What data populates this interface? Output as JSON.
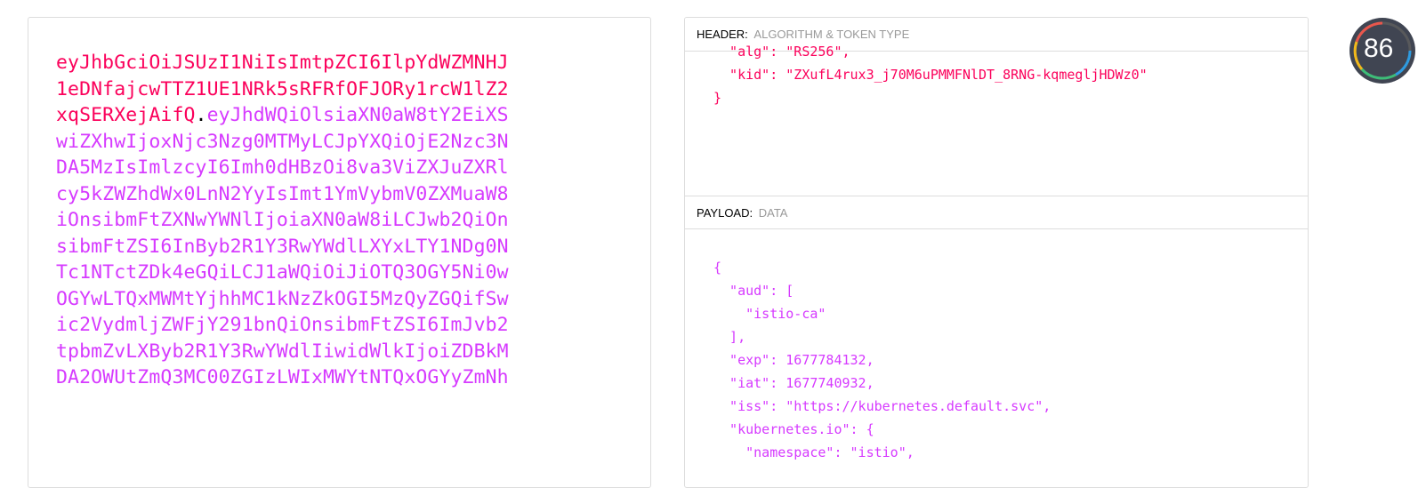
{
  "encoded": {
    "lines": [
      [
        {
          "t": "eyJhbGciOiJSUzI1NiIsImtpZCI6IlpYdWZMNHJ",
          "c": "header"
        }
      ],
      [
        {
          "t": "1eDNfajcwTTZ1UE1NRk5sRFRfOFJORy1rcW1lZ2",
          "c": "header"
        }
      ],
      [
        {
          "t": "xqSERXejAifQ",
          "c": "header"
        },
        {
          "t": ".",
          "c": "dot"
        },
        {
          "t": "eyJhdWQiOlsiaXN0aW8tY2EiXS",
          "c": "payload"
        }
      ],
      [
        {
          "t": "wiZXhwIjoxNjc3Nzg0MTMyLCJpYXQiOjE2Nzc3N",
          "c": "payload"
        }
      ],
      [
        {
          "t": "DA5MzIsImlzcyI6Imh0dHBzOi8va3ViZXJuZXRl",
          "c": "payload"
        }
      ],
      [
        {
          "t": "cy5kZWZhdWx0LnN2YyIsImt1YmVybmV0ZXMuaW8",
          "c": "payload"
        }
      ],
      [
        {
          "t": "iOnsibmFtZXNwYWNlIjoiaXN0aW8iLCJwb2QiOn",
          "c": "payload"
        }
      ],
      [
        {
          "t": "sibmFtZSI6InByb2R1Y3RwYWdlLXYxLTY1NDg0N",
          "c": "payload"
        }
      ],
      [
        {
          "t": "Tc1NTctZDk4eGQiLCJ1aWQiOiJiOTQ3OGY5Ni0w",
          "c": "payload"
        }
      ],
      [
        {
          "t": "OGYwLTQxMWMtYjhhMC1kNzZkOGI5MzQyZGQifSw",
          "c": "payload"
        }
      ],
      [
        {
          "t": "ic2VydmljZWFjY291bnQiOnsibmFtZSI6ImJvb2",
          "c": "payload"
        }
      ],
      [
        {
          "t": "tpbmZvLXByb2R1Y3RwYWdlIiwidWlkIjoiZDBkM",
          "c": "payload"
        }
      ],
      [
        {
          "t": "DA2OWUtZmQ3MC00ZGIzLWIxMWYtNTQxOGYyZmNh",
          "c": "payload"
        }
      ]
    ]
  },
  "decoded": {
    "header_section": {
      "label": "HEADER:",
      "sublabel": "ALGORITHM & TOKEN TYPE",
      "code_lines": [
        "  \"alg\": \"RS256\",",
        "  \"kid\": \"ZXufL4rux3_j70M6uPMMFNlDT_8RNG-kqmegljHDWz0\"",
        "}"
      ]
    },
    "payload_section": {
      "label": "PAYLOAD:",
      "sublabel": "DATA",
      "code_lines": [
        "{",
        "  \"aud\": [",
        "    \"istio-ca\"",
        "  ],",
        "  \"exp\": 1677784132,",
        "  \"iat\": 1677740932,",
        "  \"iss\": \"https://kubernetes.default.svc\",",
        "  \"kubernetes.io\": {",
        "    \"namespace\": \"istio\","
      ]
    }
  },
  "score_badge": {
    "value": "86"
  },
  "colors": {
    "header": "#fb015b",
    "payload": "#d63aff",
    "dot": "#000000"
  }
}
